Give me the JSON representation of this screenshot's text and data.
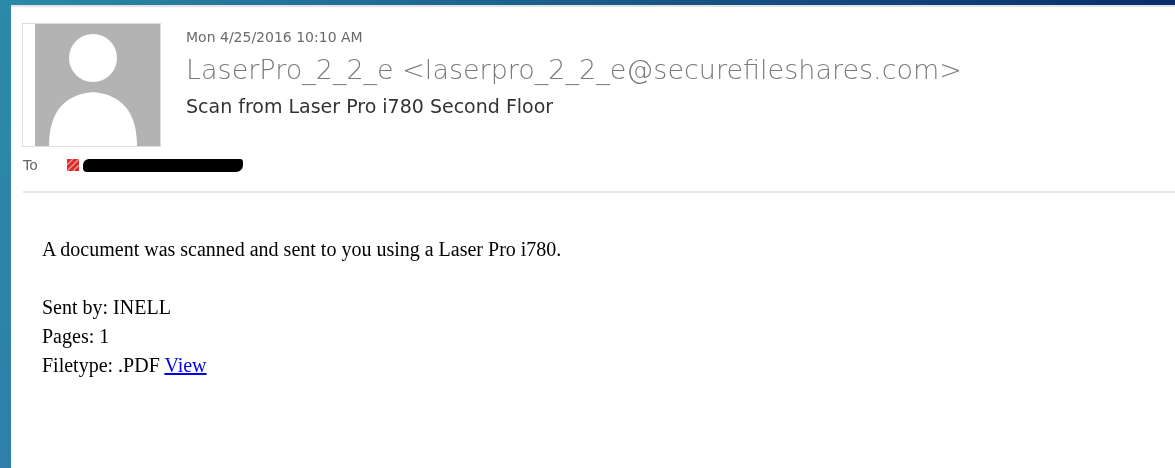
{
  "message": {
    "date": "Mon 4/25/2016 10:10 AM",
    "sender": "LaserPro_2_2_e <laserpro_2_2_e@securefileshares.com>",
    "subject": "Scan from Laser Pro i780 Second Floor",
    "to_label": "To",
    "recipients": [
      {
        "redacted": true
      }
    ]
  },
  "body": {
    "intro": "A document was scanned and sent to you using a Laser Pro i780.",
    "lines": [
      {
        "text": "Sent by: INELL"
      },
      {
        "text": "Pages: 1"
      },
      {
        "text": "Filetype: .PDF",
        "link": "View"
      }
    ]
  }
}
